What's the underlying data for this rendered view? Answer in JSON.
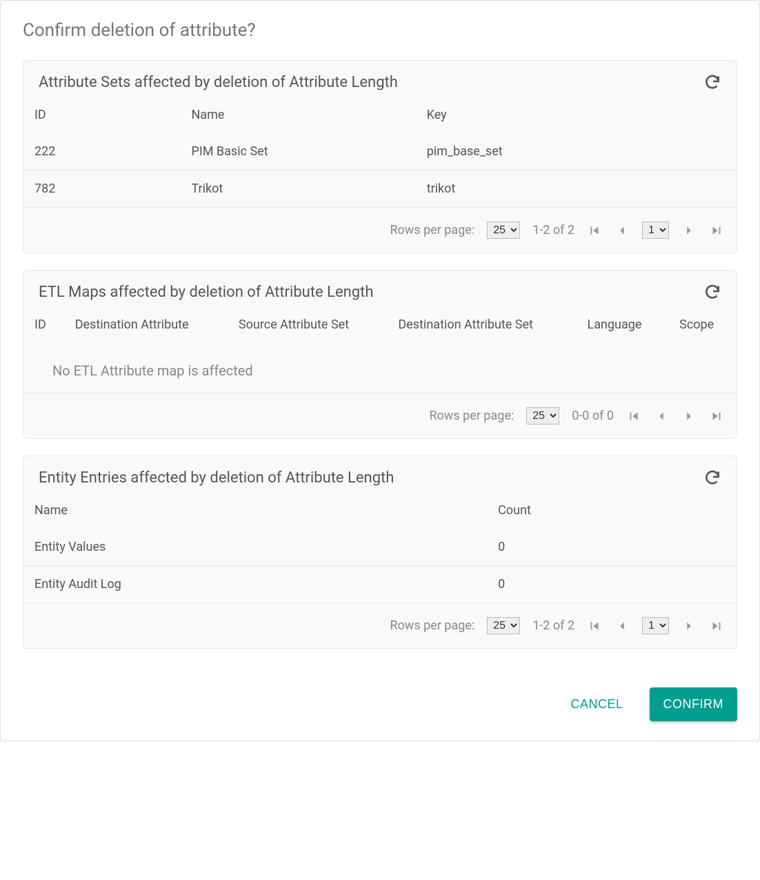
{
  "dialog": {
    "title": "Confirm deletion of attribute?"
  },
  "sections": {
    "sets": {
      "title": "Attribute Sets affected by deletion of Attribute Length",
      "columns": {
        "c0": "ID",
        "c1": "Name",
        "c2": "Key"
      },
      "rows": [
        {
          "id": "222",
          "name": "PIM Basic Set",
          "key": "pim_base_set"
        },
        {
          "id": "782",
          "name": "Trikot",
          "key": "trikot"
        }
      ],
      "pager": {
        "rpp_label": "Rows per page:",
        "rpp_value": "25",
        "range": "1-2 of 2",
        "page_value": "1",
        "show_page_select": true
      }
    },
    "etl": {
      "title": "ETL Maps affected by deletion of Attribute Length",
      "columns": {
        "c0": "ID",
        "c1": "Destination Attribute",
        "c2": "Source Attribute Set",
        "c3": "Destination Attribute Set",
        "c4": "Language",
        "c5": "Scope"
      },
      "empty": "No ETL Attribute map is affected",
      "pager": {
        "rpp_label": "Rows per page:",
        "rpp_value": "25",
        "range": "0-0 of 0",
        "show_page_select": false
      }
    },
    "entities": {
      "title": "Entity Entries affected by deletion of Attribute Length",
      "columns": {
        "c0": "Name",
        "c1": "Count"
      },
      "rows": [
        {
          "name": "Entity Values",
          "count": "0"
        },
        {
          "name": "Entity Audit Log",
          "count": "0"
        }
      ],
      "pager": {
        "rpp_label": "Rows per page:",
        "rpp_value": "25",
        "range": "1-2 of 2",
        "page_value": "1",
        "show_page_select": true
      }
    }
  },
  "actions": {
    "cancel": "CANCEL",
    "confirm": "CONFIRM"
  }
}
